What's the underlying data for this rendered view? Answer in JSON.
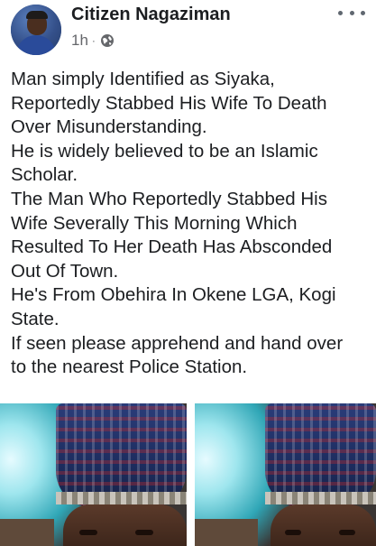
{
  "post": {
    "author": "Citizen Nagaziman",
    "time": "1h",
    "separator": "·",
    "privacy_icon": "globe-icon",
    "more_icon": "more-options-icon",
    "lines": [
      "Man simply Identified as Siyaka,",
      "Reportedly Stabbed His Wife To Death",
      "Over Misunderstanding.",
      "He is widely believed to be an Islamic",
      "Scholar.",
      "The Man Who Reportedly Stabbed His",
      "Wife Severally This Morning Which",
      "Resulted To Her Death Has Absconded",
      "Out Of Town.",
      "He's From Obehira In Okene LGA, Kogi",
      "State.",
      "If seen please apprehend and hand over",
      "to the nearest Police Station."
    ]
  },
  "colors": {
    "text": "#1c1e21",
    "meta": "#65676b"
  }
}
